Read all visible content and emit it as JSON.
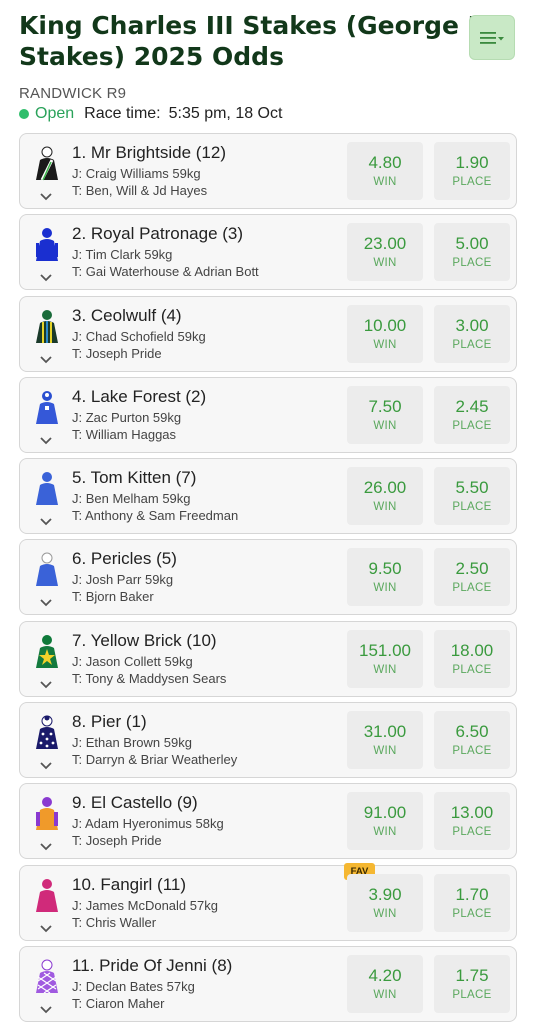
{
  "page": {
    "title": "King Charles III Stakes (George Mo",
    "title_line2": "Stakes) 2025 Odds",
    "venue": "RANDWICK R9",
    "status": "Open",
    "race_time_label": "Race time:",
    "race_time": "5:35 pm, 18 Oct"
  },
  "menu": {
    "icon": "hamburger-menu-icon"
  },
  "labels": {
    "win": "WIN",
    "place": "PLACE"
  },
  "runners": [
    {
      "name": "1. Mr Brightside (12)",
      "jockey": "J: Craig Williams 59kg",
      "trainer": "T: Ben, Will & Jd Hayes",
      "win": "4.80",
      "place": "1.90",
      "fav": ""
    },
    {
      "name": "2. Royal Patronage (3)",
      "jockey": "J: Tim Clark 59kg",
      "trainer": "T: Gai Waterhouse & Adrian Bott",
      "win": "23.00",
      "place": "5.00",
      "fav": ""
    },
    {
      "name": "3. Ceolwulf (4)",
      "jockey": "J: Chad Schofield 59kg",
      "trainer": "T: Joseph Pride",
      "win": "10.00",
      "place": "3.00",
      "fav": ""
    },
    {
      "name": "4. Lake Forest (2)",
      "jockey": "J: Zac Purton 59kg",
      "trainer": "T: William Haggas",
      "win": "7.50",
      "place": "2.45",
      "fav": ""
    },
    {
      "name": "5. Tom Kitten (7)",
      "jockey": "J: Ben Melham 59kg",
      "trainer": "T: Anthony & Sam Freedman",
      "win": "26.00",
      "place": "5.50",
      "fav": ""
    },
    {
      "name": "6. Pericles (5)",
      "jockey": "J: Josh Parr 59kg",
      "trainer": "T: Bjorn Baker",
      "win": "9.50",
      "place": "2.50",
      "fav": ""
    },
    {
      "name": "7. Yellow Brick (10)",
      "jockey": "J: Jason Collett 59kg",
      "trainer": "T: Tony & Maddysen Sears",
      "win": "151.00",
      "place": "18.00",
      "fav": ""
    },
    {
      "name": "8. Pier (1)",
      "jockey": "J: Ethan Brown 59kg",
      "trainer": "T: Darryn & Briar Weatherley",
      "win": "31.00",
      "place": "6.50",
      "fav": ""
    },
    {
      "name": "9. El Castello (9)",
      "jockey": "J: Adam Hyeronimus 58kg",
      "trainer": "T: Joseph Pride",
      "win": "91.00",
      "place": "13.00",
      "fav": ""
    },
    {
      "name": "10. Fangirl (11)",
      "jockey": "J: James McDonald 57kg",
      "trainer": "T: Chris Waller",
      "win": "3.90",
      "place": "1.70",
      "fav": "FAV"
    },
    {
      "name": "11. Pride Of Jenni (8)",
      "jockey": "J: Declan Bates 57kg",
      "trainer": "T: Ciaron Maher",
      "win": "4.20",
      "place": "1.75",
      "fav": ""
    }
  ],
  "colors": {
    "title": "#12381a",
    "open": "#2fbe6b",
    "odds_text": "#3a9a3e",
    "fav_badge": "#f5b731",
    "menu_bg": "#c9e9c6"
  }
}
